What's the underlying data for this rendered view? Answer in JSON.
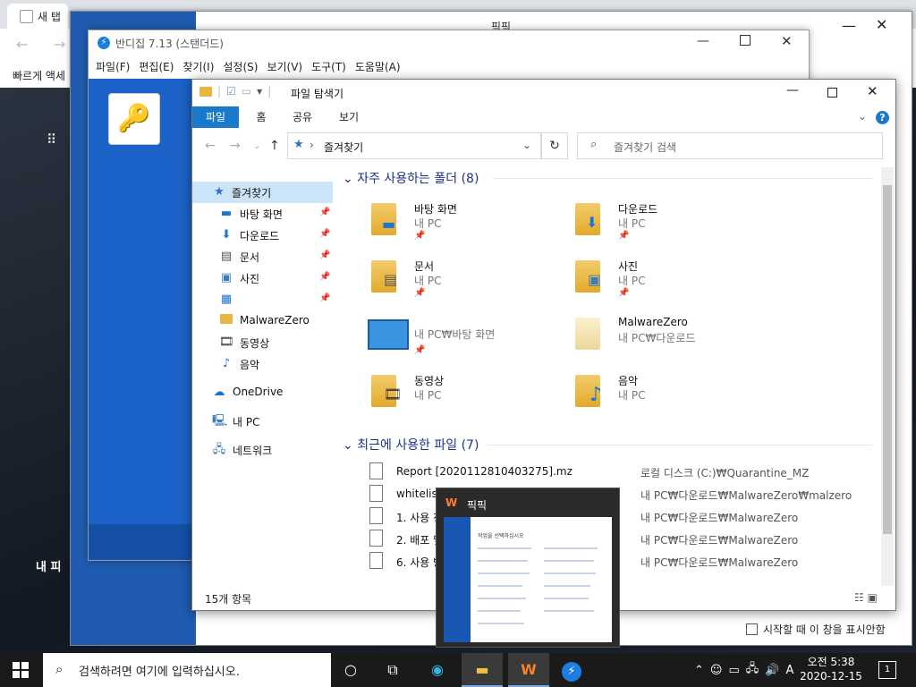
{
  "browser": {
    "tab_label": "새 탭",
    "bookmarks_label": "빠르게 액세",
    "bg_title": "내 피"
  },
  "pikpik": {
    "title": "픽픽",
    "startup_label": "시작할 때 이 창을 표시안함"
  },
  "bandizip": {
    "title": "반디집 7.13 (스탠더드)",
    "menu": [
      "파일(F)",
      "편집(E)",
      "찾기(I)",
      "설정(S)",
      "보기(V)",
      "도구(T)",
      "도움말(A)"
    ]
  },
  "explorer": {
    "title": "파일 탐색기",
    "ribbon_tabs": [
      "파일",
      "홈",
      "공유",
      "보기"
    ],
    "address": "즐겨찾기",
    "search_placeholder": "즐겨찾기 검색",
    "sidebar": [
      {
        "label": "즐겨찾기",
        "icon": "star-icon"
      },
      {
        "label": "바탕 화면",
        "icon": "desktop-icon",
        "pin": true
      },
      {
        "label": "다운로드",
        "icon": "download-icon",
        "pin": true
      },
      {
        "label": "문서",
        "icon": "document-icon",
        "pin": true
      },
      {
        "label": "사진",
        "icon": "picture-icon",
        "pin": true
      },
      {
        "label": "",
        "icon": "control-panel-icon",
        "pin": true
      },
      {
        "label": "MalwareZero",
        "icon": "folder-icon"
      },
      {
        "label": "동영상",
        "icon": "video-icon"
      },
      {
        "label": "음악",
        "icon": "music-icon"
      },
      {
        "label": "OneDrive",
        "icon": "cloud-icon"
      },
      {
        "label": "내 PC",
        "icon": "pc-icon"
      },
      {
        "label": "네트워크",
        "icon": "network-icon"
      }
    ],
    "frequent_header": "자주 사용하는 폴더 (8)",
    "frequent": [
      {
        "name": "바탕 화면",
        "sub": "내 PC",
        "pin": true
      },
      {
        "name": "다운로드",
        "sub": "내 PC",
        "pin": true
      },
      {
        "name": "문서",
        "sub": "내 PC",
        "pin": true
      },
      {
        "name": "사진",
        "sub": "내 PC",
        "pin": true
      },
      {
        "name": "",
        "sub": "내 PC₩바탕 화면",
        "pin": true
      },
      {
        "name": "MalwareZero",
        "sub": "내 PC₩다운로드",
        "pin": false
      },
      {
        "name": "동영상",
        "sub": "내 PC",
        "pin": false
      },
      {
        "name": "음악",
        "sub": "내 PC",
        "pin": false
      }
    ],
    "recent_header": "최근에 사용한 파일 (7)",
    "recent": [
      {
        "name": "Report [2020112810403275].mz",
        "loc": "로컬 디스크 (C:)₩Quarantine_MZ"
      },
      {
        "name": "whitelist",
        "loc": "내 PC₩다운로드₩MalwareZero₩malzero"
      },
      {
        "name": "1. 사용 전",
        "loc": "내 PC₩다운로드₩MalwareZero"
      },
      {
        "name": "2. 배포 및",
        "loc": "내 PC₩다운로드₩MalwareZero"
      },
      {
        "name": "6. 사용 방",
        "loc": "내 PC₩다운로드₩MalwareZero"
      }
    ],
    "status": "15개 항목"
  },
  "thumbnail": {
    "title": "픽픽",
    "prompt": "작업을 선택하십시오"
  },
  "taskbar": {
    "search_placeholder": "검색하려면 여기에 입력하십시오.",
    "clock_time": "오전 5:38",
    "clock_date": "2020-12-15",
    "ime": "A",
    "notifications": "1"
  }
}
